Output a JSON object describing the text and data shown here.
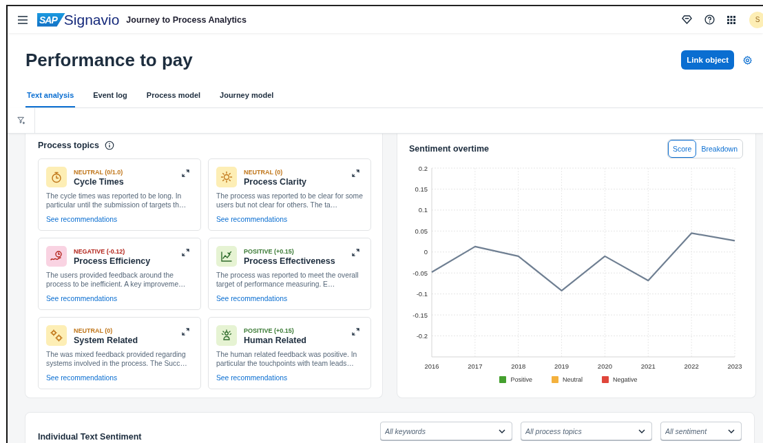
{
  "topbar": {
    "logo_mark": "SAP",
    "logo_text": "Signavio",
    "app_title": "Journey to Process Analytics",
    "avatar": "S"
  },
  "page": {
    "title": "Performance to pay",
    "primary_action": "Link object"
  },
  "tabs": [
    {
      "label": "Text analysis",
      "selected": true
    },
    {
      "label": "Event log",
      "selected": false
    },
    {
      "label": "Process model",
      "selected": false
    },
    {
      "label": "Journey model",
      "selected": false
    }
  ],
  "process_topics": {
    "title": "Process topics",
    "topics": [
      {
        "kind": "neutral",
        "score": "NEUTRAL (0/1.0)",
        "title": "Cycle Times",
        "description": "The cycle times was reported to be long. In particular until the submission of targets th…",
        "link": "See recommendations"
      },
      {
        "kind": "neutral",
        "score": "NEUTRAL (0)",
        "title": "Process Clarity",
        "description": "The process was reported to be clear for some users but not clear for others. The ta…",
        "link": "See recommendations"
      },
      {
        "kind": "negative",
        "score": "NEGATIVE (-0.12)",
        "title": "Process Efficiency",
        "description": "The users provided feedback around the process to be inefficient. A key improveme…",
        "link": "See recommendations"
      },
      {
        "kind": "positive",
        "score": "POSITIVE (+0.15)",
        "title": "Process Effectiveness",
        "description": "The process was reported to meet the overall target of performance measuring. E…",
        "link": "See recommendations"
      },
      {
        "kind": "neutral",
        "score": "NEUTRAL (0)",
        "title": "System Related",
        "description": "The was mixed feedback provided regarding systems involved in the process. The Succ…",
        "link": "See recommendations"
      },
      {
        "kind": "positive",
        "score": "POSITIVE (+0.15)",
        "title": "Human Related",
        "description": "The human related feedback was positive. In particular the touchpoints with team leads…",
        "link": "See recommendations"
      }
    ]
  },
  "sentiment_overtime": {
    "title": "Sentiment overtime",
    "toggle": [
      {
        "label": "Score",
        "selected": true
      },
      {
        "label": "Breakdown",
        "selected": false
      }
    ],
    "chart_data": {
      "type": "line",
      "x": [
        "2016",
        "2017",
        "2018",
        "2019",
        "2020",
        "2021",
        "2022",
        "2023"
      ],
      "grid": true,
      "series": [
        {
          "color": "#6f7f92",
          "values": [
            -0.048,
            0.013,
            -0.01,
            -0.092,
            -0.01,
            -0.068,
            0.045,
            0.027
          ]
        }
      ],
      "ylim": [
        -0.25,
        0.2
      ],
      "yticks": [
        0.2,
        0.15,
        0.1,
        0.05,
        0,
        -0.05,
        -0.1,
        -0.15,
        -0.2
      ]
    },
    "legend": [
      {
        "label": "Positive",
        "color": "#45a02f"
      },
      {
        "label": "Neutral",
        "color": "#f4b13d"
      },
      {
        "label": "Negative",
        "color": "#e0463b"
      }
    ]
  },
  "individual_text_sentiment": {
    "title": "Individual Text Sentiment",
    "filters": [
      {
        "placeholder": "All keywords"
      },
      {
        "placeholder": "All process topics"
      },
      {
        "placeholder": "All sentiment"
      }
    ]
  }
}
